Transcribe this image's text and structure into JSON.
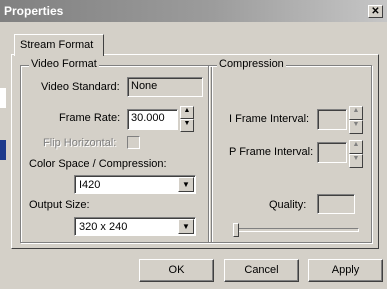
{
  "window": {
    "title": "Properties",
    "close_glyph": "✕"
  },
  "tabs": [
    {
      "label": "Stream Format"
    }
  ],
  "video_format": {
    "group_label": "Video Format",
    "video_standard_label": "Video Standard:",
    "video_standard_value": "None",
    "frame_rate_label": "Frame Rate:",
    "frame_rate_value": "30.000",
    "flip_horizontal_label": "Flip Horizontal:",
    "color_space_label": "Color Space / Compression:",
    "color_space_value": "I420",
    "output_size_label": "Output Size:",
    "output_size_value": "320 x 240"
  },
  "compression": {
    "group_label": "Compression",
    "i_frame_label": "I Frame Interval:",
    "i_frame_value": "",
    "p_frame_label": "P Frame Interval:",
    "p_frame_value": "",
    "quality_label": "Quality:",
    "quality_value": "",
    "quality_level": 0
  },
  "buttons": {
    "ok": "OK",
    "cancel": "Cancel",
    "apply": "Apply"
  },
  "icons": {
    "spin_up": "▲",
    "spin_down": "▼",
    "dropdown": "▼"
  }
}
